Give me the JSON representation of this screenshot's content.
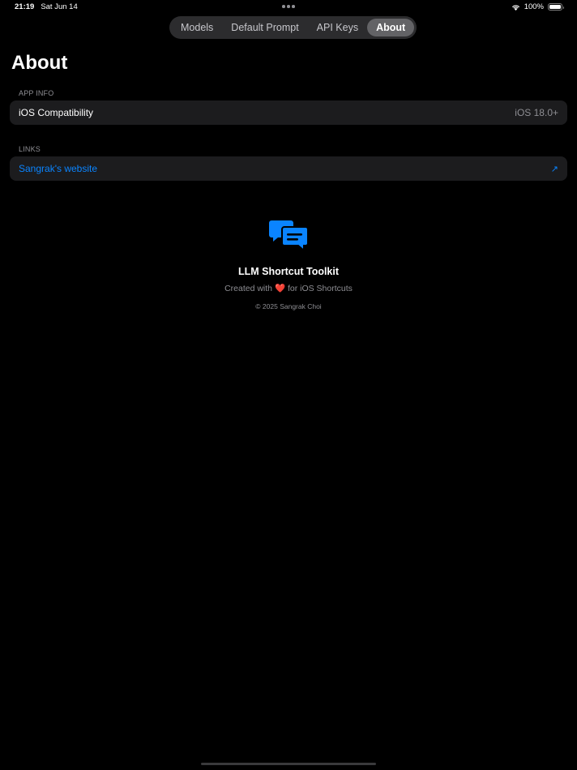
{
  "status_bar": {
    "time": "21:19",
    "date": "Sat Jun 14",
    "battery": "100%"
  },
  "tabs": [
    {
      "label": "Models",
      "active": false
    },
    {
      "label": "Default Prompt",
      "active": false
    },
    {
      "label": "API Keys",
      "active": false
    },
    {
      "label": "About",
      "active": true
    }
  ],
  "page": {
    "title": "About"
  },
  "sections": {
    "app_info": {
      "header": "APP INFO",
      "rows": [
        {
          "label": "iOS Compatibility",
          "value": "iOS 18.0+"
        }
      ]
    },
    "links": {
      "header": "LINKS",
      "rows": [
        {
          "label": "Sangrak's website",
          "icon": "external-arrow-icon"
        }
      ]
    }
  },
  "about": {
    "app_name": "LLM Shortcut Toolkit",
    "credit_prefix": "Created with",
    "heart": "❤️",
    "credit_suffix": "for iOS Shortcuts",
    "copyright": "© 2025 Sangrak Choi",
    "logo_icon": "chat-bubbles-icon",
    "accent_color": "#0a84ff"
  }
}
